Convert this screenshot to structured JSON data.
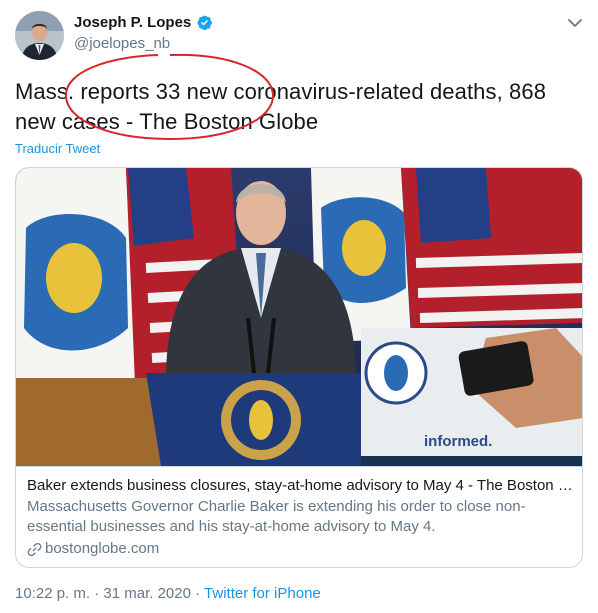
{
  "author": {
    "display_name": "Joseph P. Lopes",
    "handle": "@joelopes_nb",
    "verified": true
  },
  "tweet": {
    "text_line1": "Mass. reports 33 new coronavirus-related deaths, 868",
    "text_line2": "new cases - The Boston Globe",
    "translate_label": "Traducir Tweet"
  },
  "card": {
    "image_text": "informed.",
    "title": "Baker extends business closures, stay-at-home advisory to May 4 - The Boston Gl...",
    "description": "Massachusetts Governor Charlie Baker is extending his order to close non-essential businesses and his stay-at-home advisory to May 4.",
    "domain": "bostonglobe.com"
  },
  "footer": {
    "time": "10:22 p. m.",
    "separator": "·",
    "date": "31 mar. 2020",
    "source": "Twitter for iPhone"
  },
  "colors": {
    "link_blue": "#1b95e0",
    "secondary_text": "#657786",
    "annotation_red": "#d7262b",
    "verified_blue": "#1da1f2"
  },
  "icons": [
    "avatar",
    "verified-badge-icon",
    "chevron-down-icon",
    "link-icon"
  ]
}
